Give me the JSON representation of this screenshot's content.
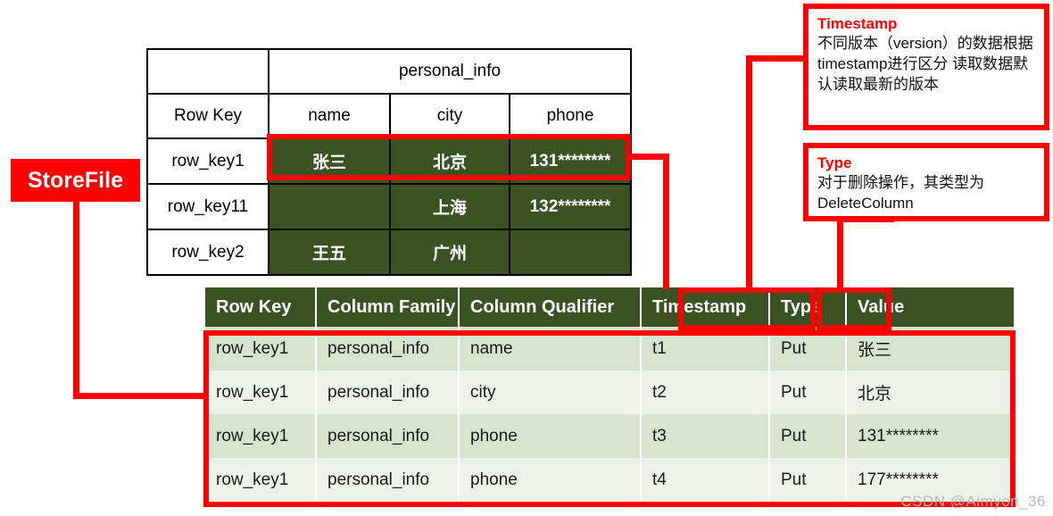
{
  "top_table": {
    "name": "hbase-logical-table",
    "column_family": "personal_info",
    "corner_blank": "",
    "headers": [
      "Row Key",
      "name",
      "city",
      "phone"
    ],
    "rows": [
      {
        "row_key": "row_key1",
        "name": "张三",
        "city": "北京",
        "phone_prefix": "131",
        "phone_stars": "********"
      },
      {
        "row_key": "row_key11",
        "name": "",
        "city": "上海",
        "phone_prefix": "132",
        "phone_stars": "********"
      },
      {
        "row_key": "row_key2",
        "name": "王五",
        "city": "广州",
        "phone_prefix": "",
        "phone_stars": ""
      }
    ]
  },
  "bottom_table": {
    "name": "storefile-kv-table",
    "headers": [
      "Row Key",
      "Column Family",
      "Column Qualifier",
      "Timestamp",
      "Type",
      "Value"
    ],
    "rows": [
      {
        "row_key": "row_key1",
        "column_family": "personal_info",
        "column_qualifier": "name",
        "timestamp": "t1",
        "type": "Put",
        "value": "张三"
      },
      {
        "row_key": "row_key1",
        "column_family": "personal_info",
        "column_qualifier": "city",
        "timestamp": "t2",
        "type": "Put",
        "value": "北京"
      },
      {
        "row_key": "row_key1",
        "column_family": "personal_info",
        "column_qualifier": "phone",
        "timestamp": "t3",
        "type": "Put",
        "value": "131********"
      },
      {
        "row_key": "row_key1",
        "column_family": "personal_info",
        "column_qualifier": "phone",
        "timestamp": "t4",
        "type": "Put",
        "value": "177********"
      }
    ]
  },
  "storefile_label": "StoreFile",
  "callouts": [
    {
      "id": "timestamp-callout",
      "title": "Timestamp",
      "body": "不同版本（version）的数据根据timestamp进行区分 读取数据默认读取最新的版本"
    },
    {
      "id": "type-callout",
      "title": "Type",
      "body": "对于删除操作，其类型为 DeleteColumn"
    }
  ],
  "watermark": "CSDN @Aimyon_36",
  "colors": {
    "accent_red": "#FF0000",
    "header_green": "#3B5323",
    "row_odd": "#D8E2CC",
    "row_even": "#EDF2E8"
  }
}
